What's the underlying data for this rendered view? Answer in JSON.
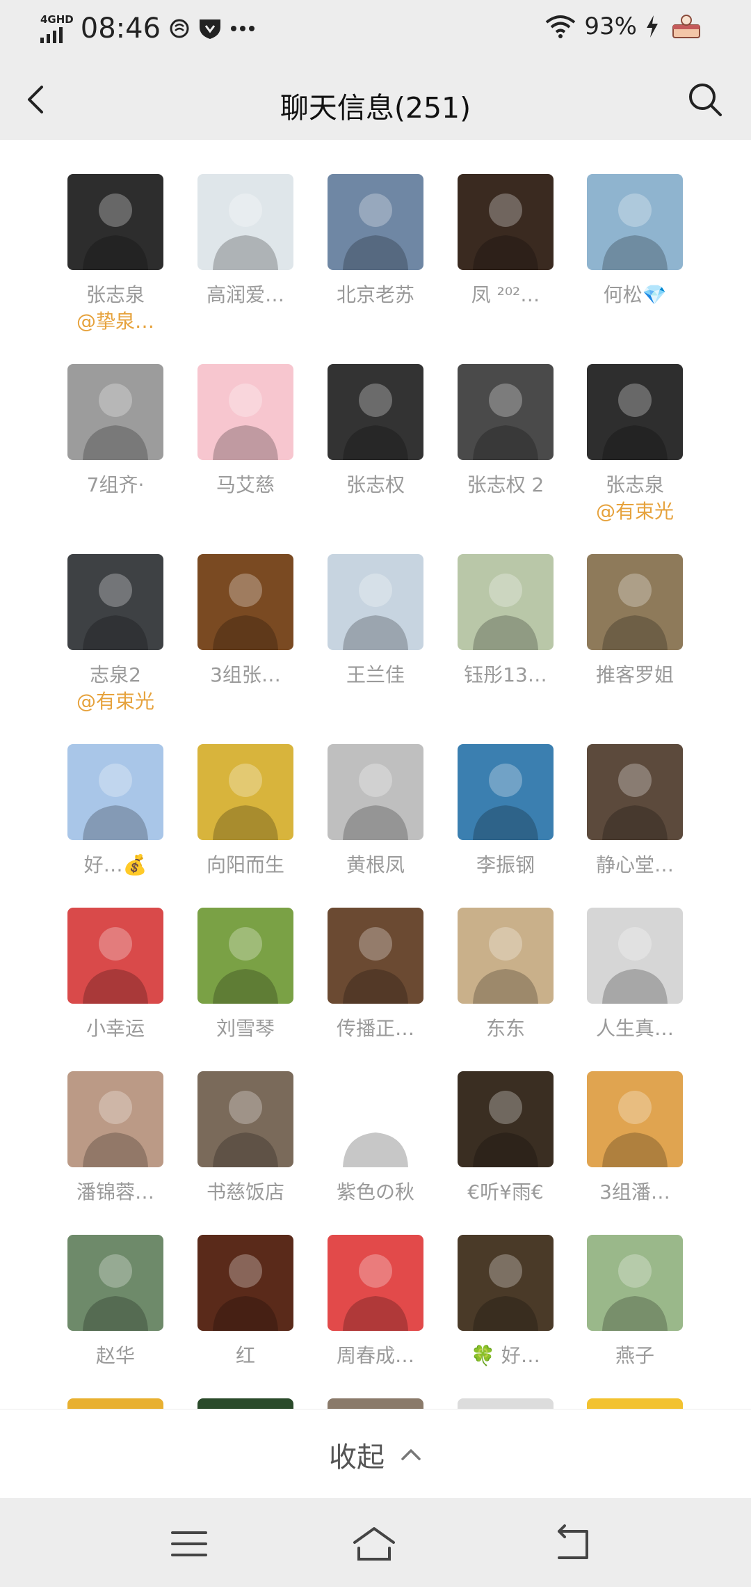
{
  "status": {
    "network": "4GHD",
    "time": "08:46",
    "battery": "93%"
  },
  "header": {
    "title": "聊天信息(251)"
  },
  "members": [
    {
      "name": "张志泉",
      "sub": "@挚泉…",
      "color": "#2d2d2d"
    },
    {
      "name": "高润爱…",
      "color": "#dfe6ea"
    },
    {
      "name": "北京老苏",
      "color": "#6f87a4"
    },
    {
      "name": "凤 ²⁰²…",
      "color": "#3a2a20"
    },
    {
      "name": "何松💎",
      "color": "#8fb4cf"
    },
    {
      "name": "7组齐·",
      "color": "#9c9c9c"
    },
    {
      "name": "马艾慈",
      "color": "#f7c6cf"
    },
    {
      "name": "张志权",
      "color": "#333333"
    },
    {
      "name": "张志权 2",
      "color": "#4a4a4a"
    },
    {
      "name": "张志泉",
      "sub": "@有束光",
      "color": "#2e2e2e"
    },
    {
      "name": "志泉2",
      "sub": "@有束光",
      "color": "#3e4144"
    },
    {
      "name": "3组张…",
      "color": "#7a4a22"
    },
    {
      "name": "王兰佳",
      "color": "#c7d4e0"
    },
    {
      "name": "钰彤13…",
      "color": "#b9c7a8"
    },
    {
      "name": "推客罗姐",
      "color": "#8e7a5a"
    },
    {
      "name": "好…💰",
      "color": "#a9c6e8"
    },
    {
      "name": "向阳而生",
      "color": "#d8b43c"
    },
    {
      "name": "黄根凤",
      "color": "#bfbfbf"
    },
    {
      "name": "李振钢",
      "color": "#3b7fb0"
    },
    {
      "name": "静心堂…",
      "color": "#5c4a3c"
    },
    {
      "name": "小幸运",
      "color": "#d94a4a"
    },
    {
      "name": "刘雪琴",
      "color": "#7aa145"
    },
    {
      "name": "传播正…",
      "color": "#6b4a32"
    },
    {
      "name": "东东",
      "color": "#c9b08a"
    },
    {
      "name": "人生真…",
      "color": "#d6d6d6"
    },
    {
      "name": "潘锦蓉…",
      "color": "#bb9a86"
    },
    {
      "name": "书慈饭店",
      "color": "#7a6a5a"
    },
    {
      "name": "紫色の秋",
      "color": "#ffffff"
    },
    {
      "name": "€听¥雨€",
      "color": "#3a2e22"
    },
    {
      "name": "3组潘…",
      "color": "#e0a450"
    },
    {
      "name": "赵华",
      "color": "#6e8a6a"
    },
    {
      "name": "红",
      "color": "#5a2a1a"
    },
    {
      "name": "周春成…",
      "color": "#e24a4a"
    },
    {
      "name": "🍀 好…",
      "color": "#4a3a28"
    },
    {
      "name": "燕子",
      "color": "#9ab88a"
    },
    {
      "name": "",
      "color": "#e8b030"
    },
    {
      "name": "",
      "color": "#2a4a2a"
    },
    {
      "name": "",
      "color": "#8a7a6a"
    },
    {
      "name": "",
      "color": "#dcdcdc"
    },
    {
      "name": "",
      "color": "#f2c230"
    }
  ],
  "collapse": {
    "label": "收起"
  },
  "icons": {
    "back": "back-arrow-icon",
    "search": "search-icon",
    "collapse": "chevron-up-icon",
    "nav_menu": "menu-icon",
    "nav_home": "home-icon",
    "nav_back": "back-icon"
  }
}
